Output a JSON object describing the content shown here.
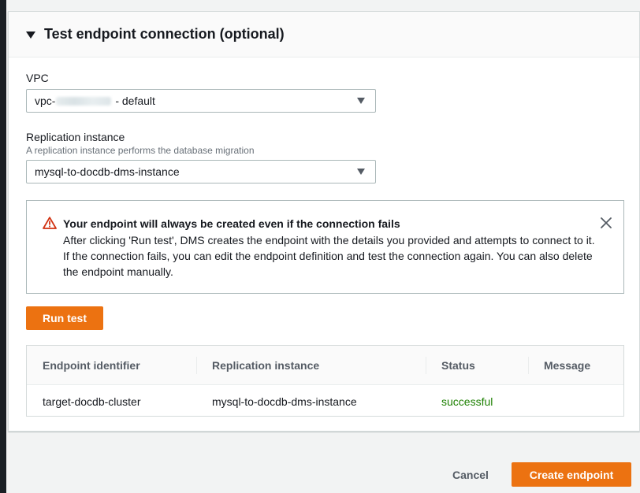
{
  "section": {
    "title": "Test endpoint connection (optional)"
  },
  "vpc": {
    "label": "VPC",
    "value_prefix": "vpc-",
    "value_suffix": " - default"
  },
  "replication": {
    "label": "Replication instance",
    "description": "A replication instance performs the database migration",
    "value": "mysql-to-docdb-dms-instance"
  },
  "alert": {
    "title": "Your endpoint will always be created even if the connection fails",
    "body": "After clicking 'Run test', DMS creates the endpoint with the details you provided and attempts to connect to it. If the connection fails, you can edit the endpoint definition and test the connection again. You can also delete the endpoint manually.",
    "icon": "warning-icon",
    "icon_color": "#d13212"
  },
  "run_test_label": "Run test",
  "results": {
    "columns": [
      "Endpoint identifier",
      "Replication instance",
      "Status",
      "Message"
    ],
    "rows": [
      {
        "endpoint_identifier": "target-docdb-cluster",
        "replication_instance": "mysql-to-docdb-dms-instance",
        "status": "successful",
        "message": ""
      }
    ]
  },
  "footer": {
    "cancel_label": "Cancel",
    "create_label": "Create endpoint"
  },
  "colors": {
    "accent": "#ec7211",
    "success": "#1d8102",
    "warning": "#d13212"
  }
}
